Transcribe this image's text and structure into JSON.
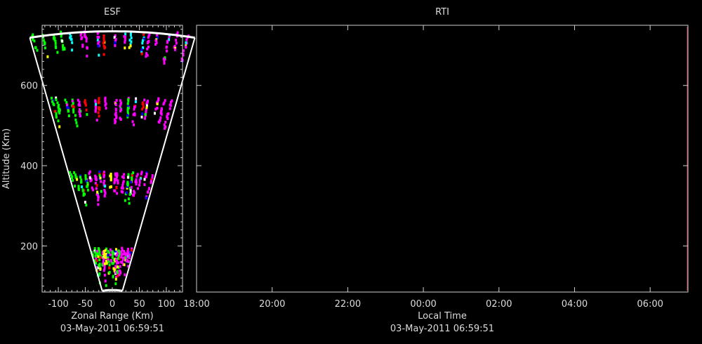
{
  "chart_data": [
    {
      "type": "scatter",
      "title": "ESF",
      "xlabel": "Zonal Range (Km)",
      "ylabel": "Altitude (Km)",
      "timestamp": "03-May-2011 06:59:51",
      "xlim": [
        -130,
        130
      ],
      "ylim": [
        85,
        750
      ],
      "xticks": [
        -100,
        -50,
        0,
        50,
        100
      ],
      "xtick_labels": [
        "-100",
        "-50",
        "0",
        "50",
        "100"
      ],
      "yticks": [
        200,
        400,
        600
      ],
      "ytick_labels": [
        "200",
        "400",
        "600"
      ],
      "fan_outer_altitude": 735,
      "fan_inner_altitude": 90,
      "fan_half_angle_deg": 12,
      "colors": [
        "#ff00ff",
        "#00ff00",
        "#ff0000",
        "#0000ff",
        "#ffffff",
        "#00ffff",
        "#ffff00"
      ],
      "echo_layers": [
        {
          "alt_min": 650,
          "alt_max": 735
        },
        {
          "alt_min": 460,
          "alt_max": 570
        },
        {
          "alt_min": 285,
          "alt_max": 385
        },
        {
          "alt_min": 95,
          "alt_max": 195
        }
      ]
    },
    {
      "type": "line",
      "title": "RTI",
      "xlabel": "Local Time",
      "timestamp": "03-May-2011 06:59:51",
      "xtick_labels": [
        "18:00",
        "20:00",
        "22:00",
        "00:00",
        "02:00",
        "04:00",
        "06:00"
      ],
      "xlim_hours": [
        18,
        31
      ],
      "ylim": [
        85,
        750
      ],
      "yticks": [
        200,
        400,
        600
      ],
      "current_time_hours": 30.9997
    }
  ]
}
